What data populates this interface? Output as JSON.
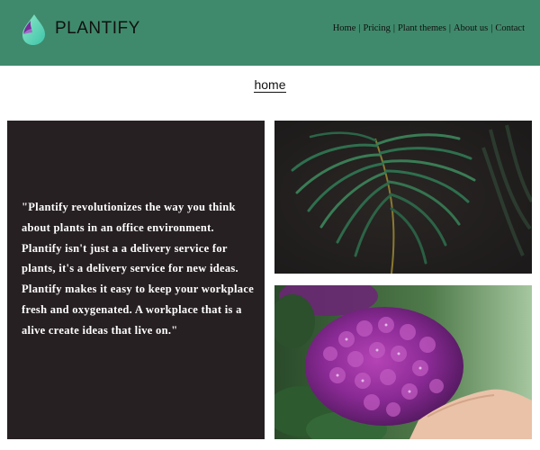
{
  "header": {
    "brand": "PLANTIFY",
    "logo_icon": "droplet-logo-icon",
    "nav": [
      {
        "label": "Home"
      },
      {
        "label": "Pricing"
      },
      {
        "label": "Plant themes"
      },
      {
        "label": "About us"
      },
      {
        "label": "Contact"
      }
    ],
    "separator": "|",
    "background": "#3f8a6c"
  },
  "page": {
    "title": "home"
  },
  "quote": {
    "text": "\"Plantify revolutionizes the way you think about plants in an office environment. Plantify isn't just a a delivery service for plants, it's a delivery service for new ideas. Plantify makes it easy to keep your workplace fresh and oxygenated. A workplace that is a alive create ideas that live on.\"",
    "background": "#272022"
  },
  "images": {
    "top": "palm-leaves-photo",
    "bottom": "purple-hydrangea-photo"
  }
}
